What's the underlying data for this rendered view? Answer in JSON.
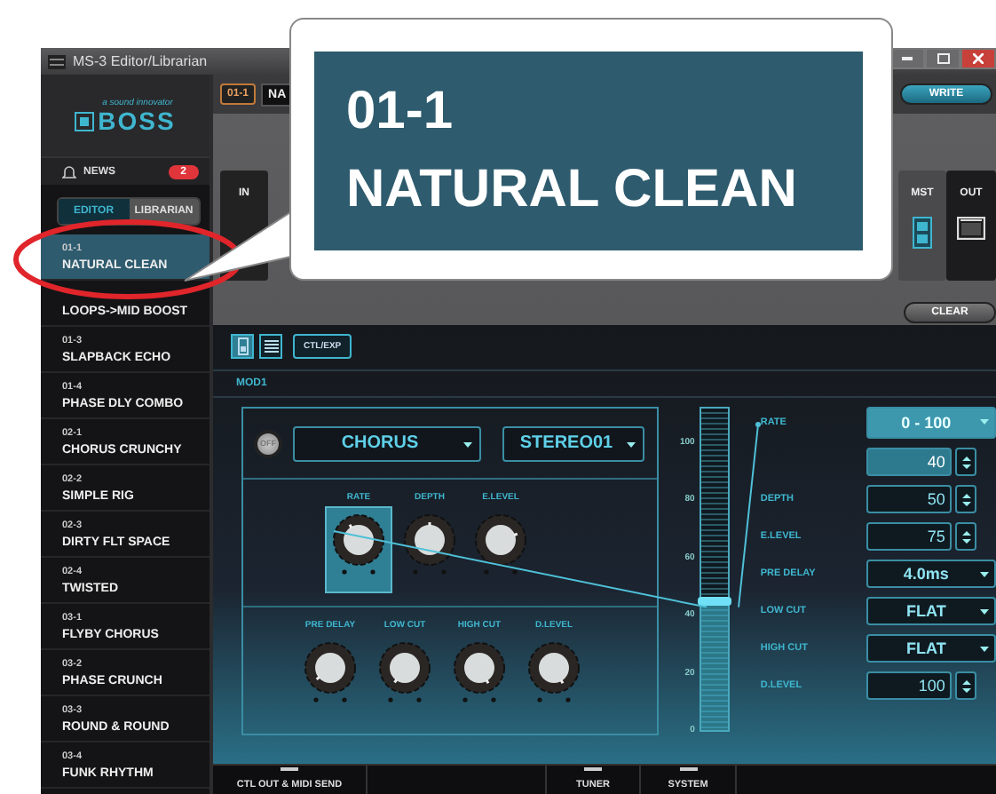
{
  "window": {
    "title": "MS-3 Editor/Librarian"
  },
  "logo": {
    "tagline": "a sound innovator",
    "brand": "BOSS"
  },
  "news": {
    "label": "NEWS",
    "count": "2"
  },
  "sidebar_tabs": [
    {
      "label": "EDITOR",
      "selected": true
    },
    {
      "label": "LIBRARIAN",
      "selected": false
    }
  ],
  "patches": [
    {
      "number": "01-1",
      "name": "NATURAL CLEAN",
      "selected": true
    },
    {
      "name": "LOOPS->MID BOOST",
      "selected": false
    },
    {
      "number": "01-3",
      "name": "SLAPBACK ECHO",
      "selected": false
    },
    {
      "number": "01-4",
      "name": "PHASE DLY COMBO",
      "selected": false
    },
    {
      "number": "02-1",
      "name": "CHORUS CRUNCHY",
      "selected": false
    },
    {
      "number": "02-2",
      "name": "SIMPLE RIG",
      "selected": false
    },
    {
      "number": "02-3",
      "name": "DIRTY FLT SPACE",
      "selected": false
    },
    {
      "number": "02-4",
      "name": "TWISTED",
      "selected": false
    },
    {
      "number": "03-1",
      "name": "FLYBY CHORUS",
      "selected": false
    },
    {
      "number": "03-2",
      "name": "PHASE CRUNCH",
      "selected": false
    },
    {
      "number": "03-3",
      "name": "ROUND & ROUND",
      "selected": false
    },
    {
      "number": "03-4",
      "name": "FUNK RHYTHM",
      "selected": false
    }
  ],
  "header": {
    "patch_number": "01-1",
    "patch_name": "NA",
    "write": "WRITE",
    "clear": "CLEAR"
  },
  "chain": [
    {
      "label": "IN",
      "kind": "input"
    },
    {
      "label": "MST",
      "kind": "master"
    },
    {
      "label": "OUT",
      "kind": "output"
    }
  ],
  "editor": {
    "views": [
      {
        "kind": "pedal",
        "selected": true
      },
      {
        "kind": "list",
        "selected": false
      }
    ],
    "ctl_exp": "CTL/EXP",
    "block": "MOD1",
    "effect": {
      "on": false,
      "switch_label": "OFF",
      "type": "CHORUS",
      "mode": "STEREO01"
    },
    "knob_rows": [
      [
        {
          "label": "RATE",
          "selected": true
        },
        {
          "label": "DEPTH",
          "selected": false
        },
        {
          "label": "E.LEVEL",
          "selected": false
        }
      ],
      [
        {
          "label": "PRE DELAY",
          "selected": false
        },
        {
          "label": "LOW CUT",
          "selected": false
        },
        {
          "label": "HIGH CUT",
          "selected": false
        },
        {
          "label": "D.LEVEL",
          "selected": false
        }
      ]
    ],
    "slider": {
      "ticks": [
        "100",
        "80",
        "60",
        "40",
        "20",
        "0"
      ],
      "level": 0.4
    },
    "params": [
      {
        "label": "RATE",
        "kind": "number",
        "range": "0 - 100",
        "value": "40",
        "selected": true
      },
      {
        "label": "DEPTH",
        "kind": "number",
        "value": "50",
        "selected": false
      },
      {
        "label": "E.LEVEL",
        "kind": "number",
        "value": "75",
        "selected": false
      },
      {
        "label": "PRE DELAY",
        "kind": "select",
        "value": "4.0ms",
        "selected": false
      },
      {
        "label": "LOW CUT",
        "kind": "select",
        "value": "FLAT",
        "selected": false
      },
      {
        "label": "HIGH CUT",
        "kind": "select",
        "value": "FLAT",
        "selected": false
      },
      {
        "label": "D.LEVEL",
        "kind": "number",
        "value": "100",
        "selected": false
      }
    ]
  },
  "bottom_tabs": [
    {
      "label": "CTL OUT & MIDI SEND"
    },
    {
      "label": "TUNER"
    },
    {
      "label": "SYSTEM"
    }
  ],
  "callout": {
    "number": "01-1",
    "name": "NATURAL CLEAN"
  }
}
